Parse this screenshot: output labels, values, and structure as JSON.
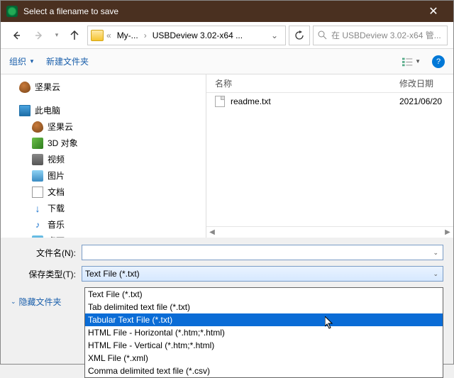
{
  "title": "Select a filename to save",
  "nav": {
    "crumb1": "My-...",
    "crumb2": "USBDeview 3.02-x64 ..."
  },
  "search_placeholder": "在 USBDeview 3.02-x64 管...",
  "toolbar": {
    "organize": "组织",
    "newfolder": "新建文件夹"
  },
  "tree": {
    "nut1": "坚果云",
    "pc": "此电脑",
    "nut2": "坚果云",
    "d3": "3D 对象",
    "video": "视频",
    "pic": "图片",
    "doc": "文档",
    "dl": "下载",
    "music": "音乐",
    "desk": "桌面"
  },
  "filelist": {
    "col_name": "名称",
    "col_date": "修改日期",
    "rows": [
      {
        "name": "readme.txt",
        "date": "2021/06/20"
      }
    ]
  },
  "fields": {
    "filename_label": "文件名(N):",
    "filename_value": "",
    "type_label": "保存类型(T):",
    "type_value": "Text File (*.txt)"
  },
  "hide_folders": "隐藏文件夹",
  "type_options": [
    "Text File (*.txt)",
    "Tab delimited text file (*.txt)",
    "Tabular Text File (*.txt)",
    "HTML File - Horizontal (*.htm;*.html)",
    "HTML File - Vertical (*.htm;*.html)",
    "XML File (*.xml)",
    "Comma delimited text file (*.csv)"
  ],
  "type_selected_index": 2
}
